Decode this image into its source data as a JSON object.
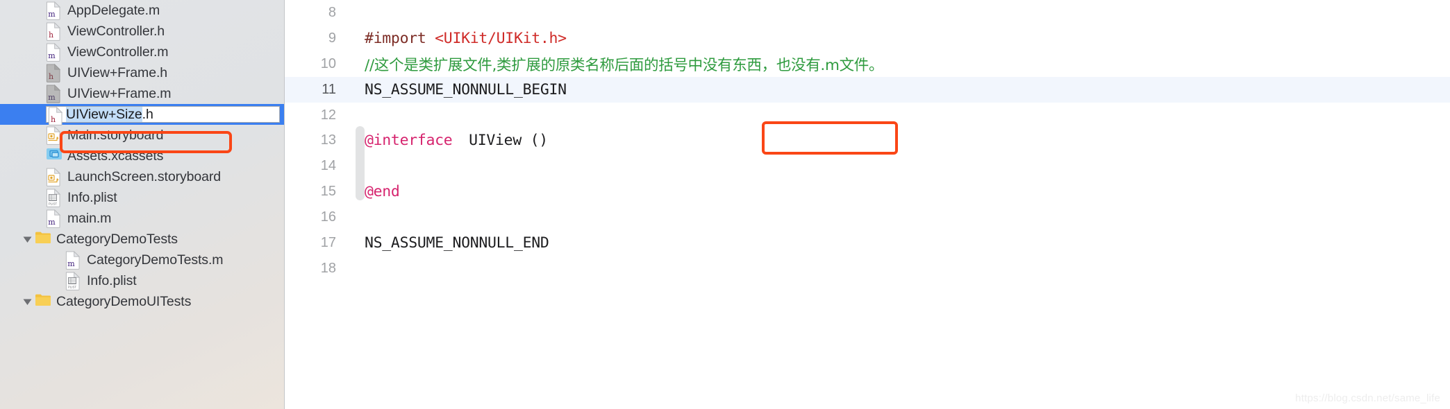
{
  "colors": {
    "annotation": "#fa4616",
    "selection_blue": "#3b7ff0",
    "text_selection": "#c3ddf7",
    "current_line": "#f2f6fd",
    "keyword_magenta": "#d6246e",
    "comment_green": "#2f9b3f",
    "include_red": "#cf2b28",
    "preprocessor_red": "#7d2d26",
    "sidebar_bg": "#e2e4e7",
    "folder_yellow": "#f5c445"
  },
  "sidebar": {
    "name": "project-navigator",
    "rows": [
      {
        "label": "AppDelegate.m",
        "icon": "objc-source-file-icon",
        "indent": 2,
        "kind": "file",
        "dimmed": false
      },
      {
        "label": "ViewController.h",
        "icon": "objc-header-file-icon",
        "indent": 2,
        "kind": "file",
        "dimmed": false
      },
      {
        "label": "ViewController.m",
        "icon": "objc-source-file-icon",
        "indent": 2,
        "kind": "file",
        "dimmed": false
      },
      {
        "label": "UIView+Frame.h",
        "icon": "objc-header-file-icon",
        "indent": 2,
        "kind": "file",
        "dimmed": true
      },
      {
        "label": "UIView+Frame.m",
        "icon": "objc-source-file-icon",
        "indent": 2,
        "kind": "file",
        "dimmed": true
      },
      {
        "label": "UIView+Size.h",
        "icon": "objc-header-file-icon",
        "indent": 2,
        "kind": "file",
        "dimmed": false,
        "selected": true,
        "renaming": true
      },
      {
        "label": "Main.storyboard",
        "icon": "storyboard-file-icon",
        "indent": 2,
        "kind": "file",
        "dimmed": false
      },
      {
        "label": "Assets.xcassets",
        "icon": "asset-catalog-icon",
        "indent": 2,
        "kind": "file",
        "dimmed": false
      },
      {
        "label": "LaunchScreen.storyboard",
        "icon": "storyboard-file-icon",
        "indent": 2,
        "kind": "file",
        "dimmed": false
      },
      {
        "label": "Info.plist",
        "icon": "plist-file-icon",
        "indent": 2,
        "kind": "file",
        "dimmed": false
      },
      {
        "label": "main.m",
        "icon": "objc-source-file-icon",
        "indent": 2,
        "kind": "file",
        "dimmed": false
      },
      {
        "label": "CategoryDemoTests",
        "icon": "folder-icon",
        "indent": 1,
        "kind": "group",
        "dimmed": false,
        "expanded": true
      },
      {
        "label": "CategoryDemoTests.m",
        "icon": "objc-source-file-icon",
        "indent": 3,
        "kind": "file",
        "dimmed": false
      },
      {
        "label": "Info.plist",
        "icon": "plist-file-icon",
        "indent": 3,
        "kind": "file",
        "dimmed": false
      },
      {
        "label": "CategoryDemoUITests",
        "icon": "folder-icon",
        "indent": 1,
        "kind": "group",
        "dimmed": false,
        "expanded": true
      }
    ],
    "rename": {
      "selected_part": "UIView+Size",
      "unselected_part": ".h",
      "full_value": "UIView+Size.h"
    }
  },
  "editor": {
    "name": "source-code-editor",
    "lines": [
      {
        "number": "8",
        "current": false,
        "tokens": []
      },
      {
        "number": "9",
        "current": false,
        "tokens": [
          {
            "text": "#import ",
            "style": "pp"
          },
          {
            "text": "<UIKit/UIKit.h>",
            "style": "include"
          }
        ]
      },
      {
        "number": "10",
        "current": false,
        "tokens": [
          {
            "text": "//这个是类扩展文件,类扩展的原类名称后面的括号中没有东西，也没有.m文件。",
            "style": "comment"
          }
        ]
      },
      {
        "number": "11",
        "current": true,
        "tokens": [
          {
            "text": "NS_ASSUME_NONNULL_BEGIN",
            "style": "plain"
          }
        ]
      },
      {
        "number": "12",
        "current": false,
        "tokens": []
      },
      {
        "number": "13",
        "current": false,
        "tokens": [
          {
            "text": "@interface ",
            "style": "keyword"
          },
          {
            "text": "UIView ()",
            "style": "boxed"
          }
        ]
      },
      {
        "number": "14",
        "current": false,
        "tokens": []
      },
      {
        "number": "15",
        "current": false,
        "tokens": [
          {
            "text": "@end",
            "style": "keyword"
          }
        ]
      },
      {
        "number": "16",
        "current": false,
        "tokens": []
      },
      {
        "number": "17",
        "current": false,
        "tokens": [
          {
            "text": "NS_ASSUME_NONNULL_END",
            "style": "plain"
          }
        ]
      },
      {
        "number": "18",
        "current": false,
        "tokens": []
      }
    ],
    "fold_ribbon": {
      "start_line": "13",
      "end_line": "15"
    }
  },
  "annotations": [
    {
      "name": "annotation-rect-filename",
      "target": "rename-field"
    },
    {
      "name": "annotation-rect-interface-class",
      "target": "UIView ()"
    }
  ],
  "watermark": {
    "text": "https://blog.csdn.net/same_life"
  }
}
